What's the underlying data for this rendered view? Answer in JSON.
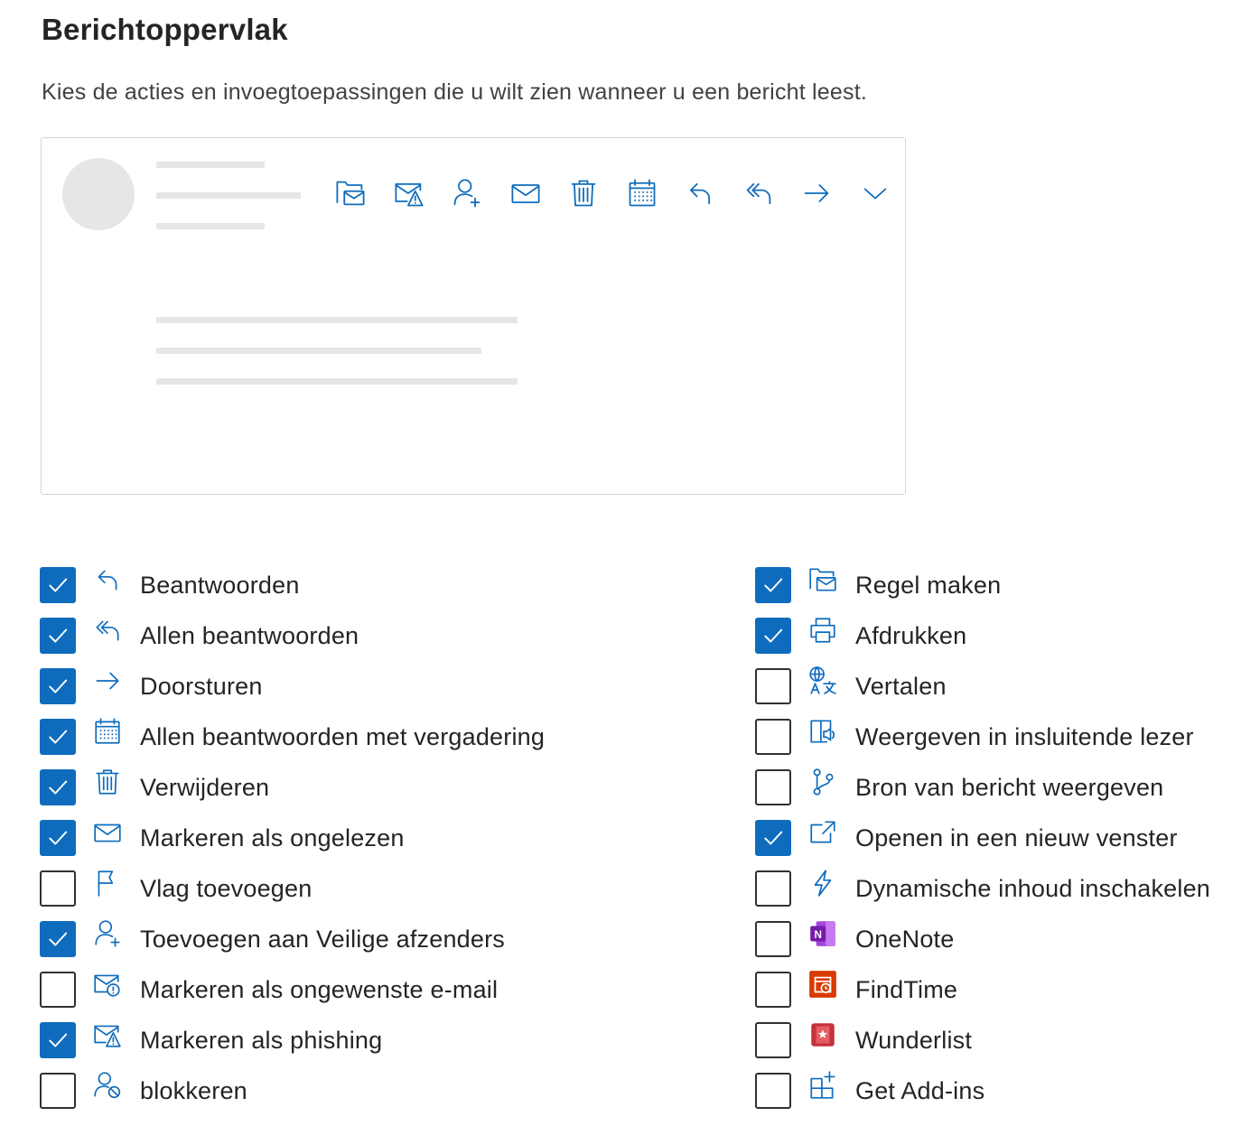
{
  "header": {
    "title": "Berichtoppervlak",
    "subtitle": "Kies de acties en invoegtoepassingen die u wilt zien wanneer u een bericht leest."
  },
  "colors": {
    "accent": "#0f6cbd",
    "icon_stroke": "#0f6cbd",
    "placeholder": "#e6e6e6"
  },
  "preview_toolbar": [
    {
      "icon": "rule-icon"
    },
    {
      "icon": "phishing-icon"
    },
    {
      "icon": "add-person-icon"
    },
    {
      "icon": "mail-icon"
    },
    {
      "icon": "delete-icon"
    },
    {
      "icon": "calendar-icon"
    },
    {
      "icon": "reply-icon"
    },
    {
      "icon": "reply-all-icon"
    },
    {
      "icon": "forward-icon"
    },
    {
      "icon": "chevron-down-icon"
    }
  ],
  "options_left": [
    {
      "label": "Beantwoorden",
      "checked": true,
      "icon": "reply-icon"
    },
    {
      "label": "Allen beantwoorden",
      "checked": true,
      "icon": "reply-all-icon"
    },
    {
      "label": "Doorsturen",
      "checked": true,
      "icon": "forward-icon"
    },
    {
      "label": "Allen beantwoorden met vergadering",
      "checked": true,
      "icon": "calendar-icon"
    },
    {
      "label": "Verwijderen",
      "checked": true,
      "icon": "delete-icon"
    },
    {
      "label": "Markeren als ongelezen",
      "checked": true,
      "icon": "mail-icon"
    },
    {
      "label": "Vlag toevoegen",
      "checked": false,
      "icon": "flag-icon"
    },
    {
      "label": "Toevoegen aan Veilige afzenders",
      "checked": true,
      "icon": "add-person-icon"
    },
    {
      "label": "Markeren als ongewenste e-mail",
      "checked": false,
      "icon": "junk-icon"
    },
    {
      "label": "Markeren als phishing",
      "checked": true,
      "icon": "phishing-icon"
    },
    {
      "label": "blokkeren",
      "checked": false,
      "icon": "block-person-icon"
    }
  ],
  "options_right": [
    {
      "label": "Regel maken",
      "checked": true,
      "icon": "rule-icon"
    },
    {
      "label": "Afdrukken",
      "checked": true,
      "icon": "print-icon"
    },
    {
      "label": "Vertalen",
      "checked": false,
      "icon": "translate-icon"
    },
    {
      "label": "Weergeven in insluitende lezer",
      "checked": false,
      "icon": "immersive-reader-icon"
    },
    {
      "label": "Bron van bericht weergeven",
      "checked": false,
      "icon": "source-icon"
    },
    {
      "label": "Openen in een nieuw venster",
      "checked": true,
      "icon": "open-window-icon"
    },
    {
      "label": "Dynamische inhoud inschakelen",
      "checked": false,
      "icon": "flash-icon"
    },
    {
      "label": "OneNote",
      "checked": false,
      "icon": "onenote-icon"
    },
    {
      "label": "FindTime",
      "checked": false,
      "icon": "findtime-icon"
    },
    {
      "label": "Wunderlist",
      "checked": false,
      "icon": "wunderlist-icon"
    },
    {
      "label": "Get Add-ins",
      "checked": false,
      "icon": "get-addins-icon"
    }
  ]
}
